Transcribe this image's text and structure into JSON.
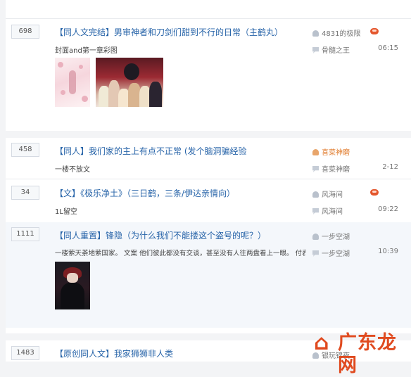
{
  "threads": [
    {
      "count": "698",
      "tag": "【同人文完结】",
      "title": "男审神者和刀剑们甜到不行的日常（主鹤丸）",
      "snippet": "封面and第一章彩图",
      "author": "4831的极限",
      "last_reply": "骨髓之王",
      "time": "06:15",
      "hot": true,
      "images": [
        "cover-image",
        "chapter-one-color-art"
      ]
    },
    {
      "count": "458",
      "tag": "【同人】",
      "title": "我们家的主上有点不正常 (发个脑洞骗经验",
      "snippet": "一楼不放文",
      "author": "喜菜神磨",
      "last_reply": "喜菜神磨",
      "time": "2-12",
      "hot": false
    },
    {
      "count": "34",
      "tag": "【文】",
      "title": "《极乐净土》（三日鹤，三条/伊达亲情向）",
      "snippet": "1L留空",
      "author": "风海间",
      "last_reply": "风海间",
      "time": "09:22",
      "hot": true
    },
    {
      "count": "1111",
      "tag": "【同人重置】",
      "title": "锋隐（为什么我们不能搂这个盗号的呢？）",
      "snippet": "一楼萦天荼地萦国家。 文案 他们彼此都没有交谈，甚至没有人往两盘看上一眼。 付表...",
      "author": "一步空湖",
      "last_reply": "一步空湖",
      "time": "10:39",
      "hot": false,
      "images": [
        "cover-image"
      ]
    },
    {
      "count": "1483",
      "tag": "【原创同人文】",
      "title": "我家狮狮非人类",
      "author": "银玩锦夜",
      "hot": false
    }
  ],
  "watermark": {
    "text": "广东龙网"
  },
  "colors": {
    "link": "#2663a8",
    "hot": "#e4572e",
    "author_highlight": "#e07a2a"
  },
  "icons": {
    "author": "user-icon",
    "reply": "reply-icon",
    "hot": "hot-badge-icon"
  }
}
